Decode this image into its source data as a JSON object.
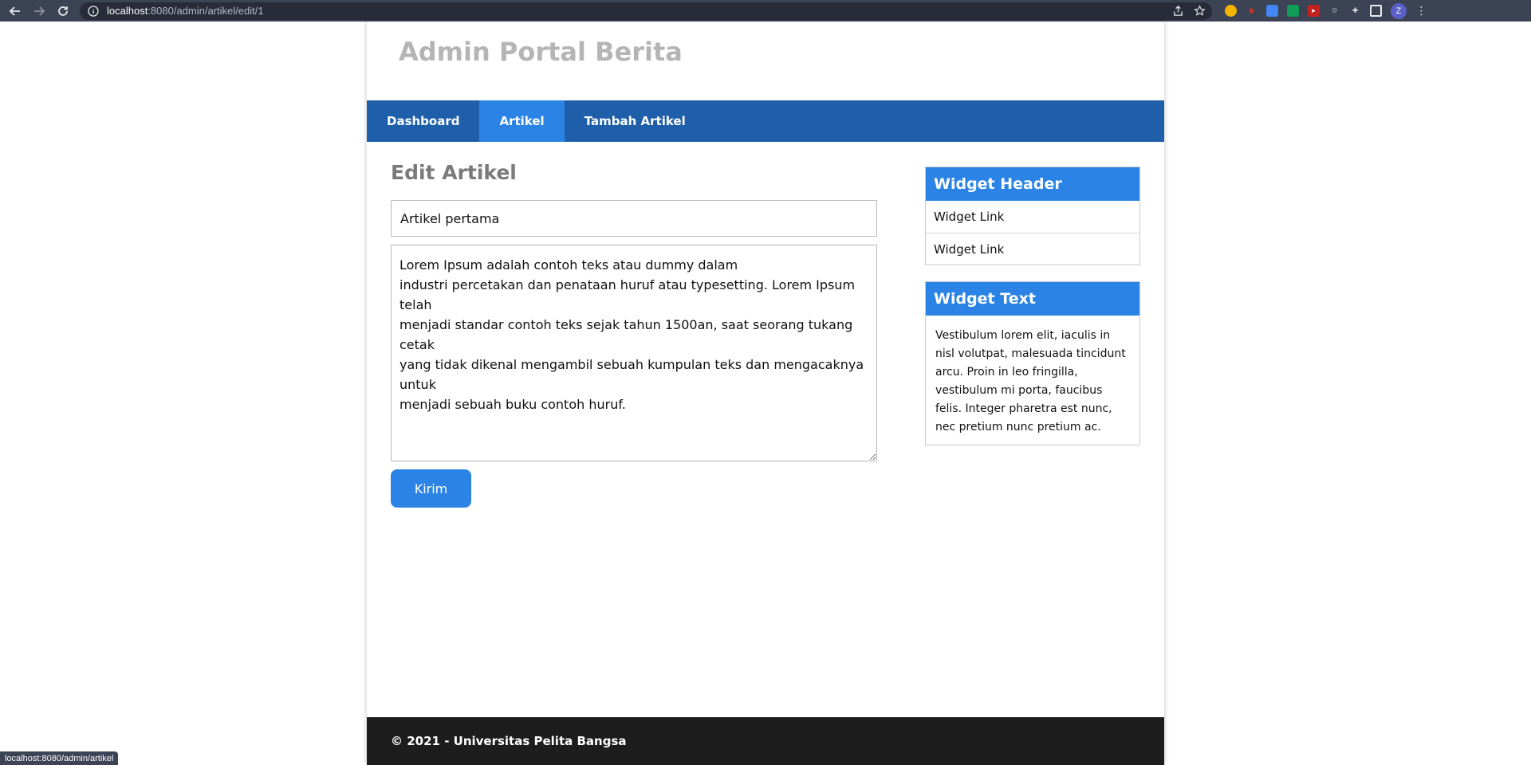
{
  "browser": {
    "url_host": "localhost",
    "url_path": ":8080/admin/artikel/edit/1",
    "profile_initial": "Z"
  },
  "site": {
    "title": "Admin Portal Berita"
  },
  "nav": {
    "items": [
      {
        "label": "Dashboard"
      },
      {
        "label": "Artikel"
      },
      {
        "label": "Tambah Artikel"
      }
    ]
  },
  "main": {
    "page_title": "Edit Artikel",
    "title_value": "Artikel pertama",
    "body_value": "Lorem Ipsum adalah contoh teks atau dummy dalam\nindustri percetakan dan penataan huruf atau typesetting. Lorem Ipsum telah\nmenjadi standar contoh teks sejak tahun 1500an, saat seorang tukang cetak\nyang tidak dikenal mengambil sebuah kumpulan teks dan mengacaknya untuk\nmenjadi sebuah buku contoh huruf.",
    "submit_label": "Kirim"
  },
  "sidebar": {
    "widget1": {
      "header": "Widget Header",
      "links": [
        "Widget Link",
        "Widget Link"
      ]
    },
    "widget2": {
      "header": "Widget Text",
      "text": "Vestibulum lorem elit, iaculis in nisl volutpat, malesuada tincidunt arcu. Proin in leo fringilla, vestibulum mi porta, faucibus felis. Integer pharetra est nunc, nec pretium nunc pretium ac."
    }
  },
  "footer": {
    "text": "© 2021 - Universitas Pelita Bangsa"
  },
  "status_bar": {
    "text": "localhost:8080/admin/artikel"
  },
  "colors": {
    "nav_bg": "#1f5faa",
    "accent": "#2b84e5",
    "footer_bg": "#1d1d1d",
    "title_gray": "#b5b5b5"
  }
}
